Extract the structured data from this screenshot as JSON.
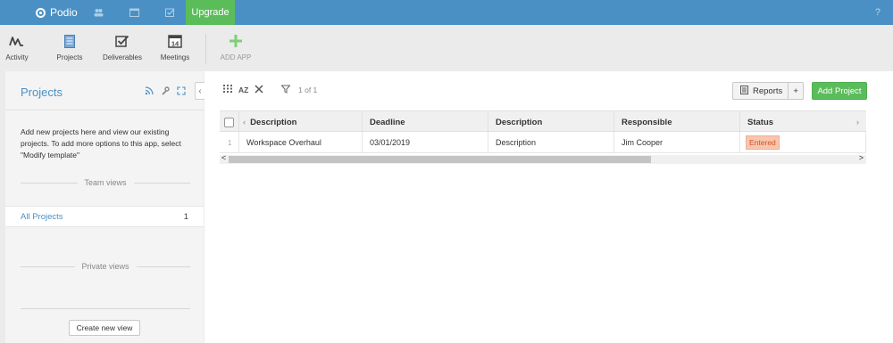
{
  "topbar": {
    "brand": "Podio",
    "upgrade_label": "Upgrade",
    "help_label": "?",
    "icons": [
      "people-icon",
      "calendar-icon",
      "tasks-icon"
    ]
  },
  "apps": [
    {
      "label": "Activity",
      "icon": "activity-icon"
    },
    {
      "label": "Projects",
      "icon": "projects-icon"
    },
    {
      "label": "Deliverables",
      "icon": "deliverables-icon"
    },
    {
      "label": "Meetings",
      "icon": "meetings-icon",
      "day": "14"
    },
    {
      "label": "ADD APP",
      "icon": "plus-icon"
    }
  ],
  "sidebar": {
    "title": "Projects",
    "description": "Add new projects here and view our existing projects. To add more options to this app, select \"Modify template\"",
    "team_views_label": "Team views",
    "views": [
      {
        "name": "All Projects",
        "count": "1"
      }
    ],
    "private_views_label": "Private views",
    "create_view_label": "Create new view"
  },
  "main": {
    "filter_count": "1 of 1",
    "sort_label": "AZ",
    "reports_label": "Reports",
    "reports_plus": "+",
    "add_label": "Add Project"
  },
  "table": {
    "columns": [
      "Description",
      "Deadline",
      "Description",
      "Responsible",
      "Status"
    ],
    "rows": [
      {
        "index": "1",
        "description": "Workspace Overhaul",
        "deadline": "03/01/2019",
        "description2": "Description",
        "responsible": "Jim Cooper",
        "status": "Entered"
      }
    ]
  },
  "colors": {
    "accent": "#4a90c4",
    "green": "#5bbd5a",
    "status_bg": "#f7c6ad"
  }
}
